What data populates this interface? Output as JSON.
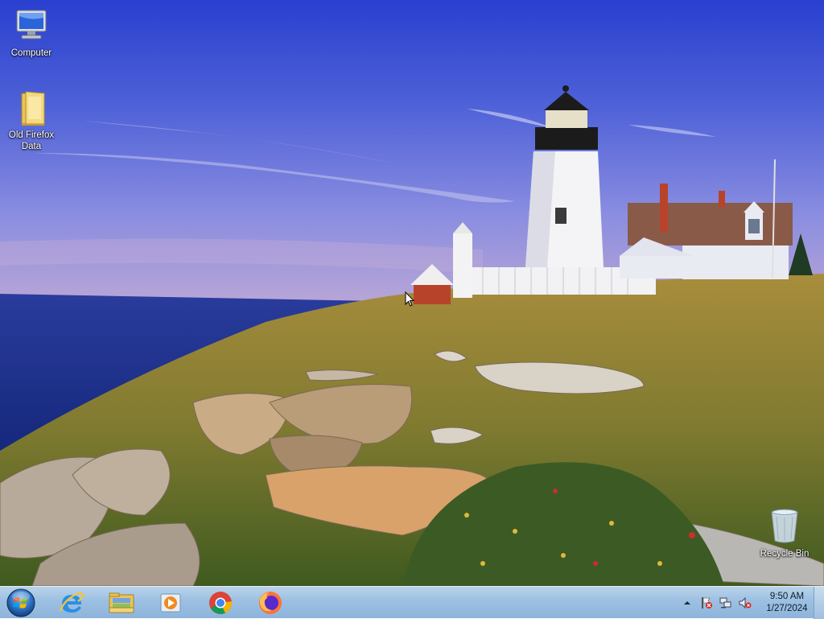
{
  "desktop": {
    "icons": [
      {
        "name": "computer",
        "label": "Computer"
      },
      {
        "name": "folder",
        "label": "Old Firefox Data"
      },
      {
        "name": "recycle-bin",
        "label": "Recycle Bin"
      }
    ]
  },
  "taskbar": {
    "pinned": [
      "internet-explorer-icon",
      "file-explorer-icon",
      "media-player-icon",
      "chrome-icon",
      "firefox-icon"
    ],
    "clock": {
      "time": "9:50 AM",
      "date": "1/27/2024"
    }
  },
  "colors": {
    "taskbar": "#9cc0e2",
    "sky_top": "#2f43c9",
    "sea": "#1c3aa5"
  }
}
